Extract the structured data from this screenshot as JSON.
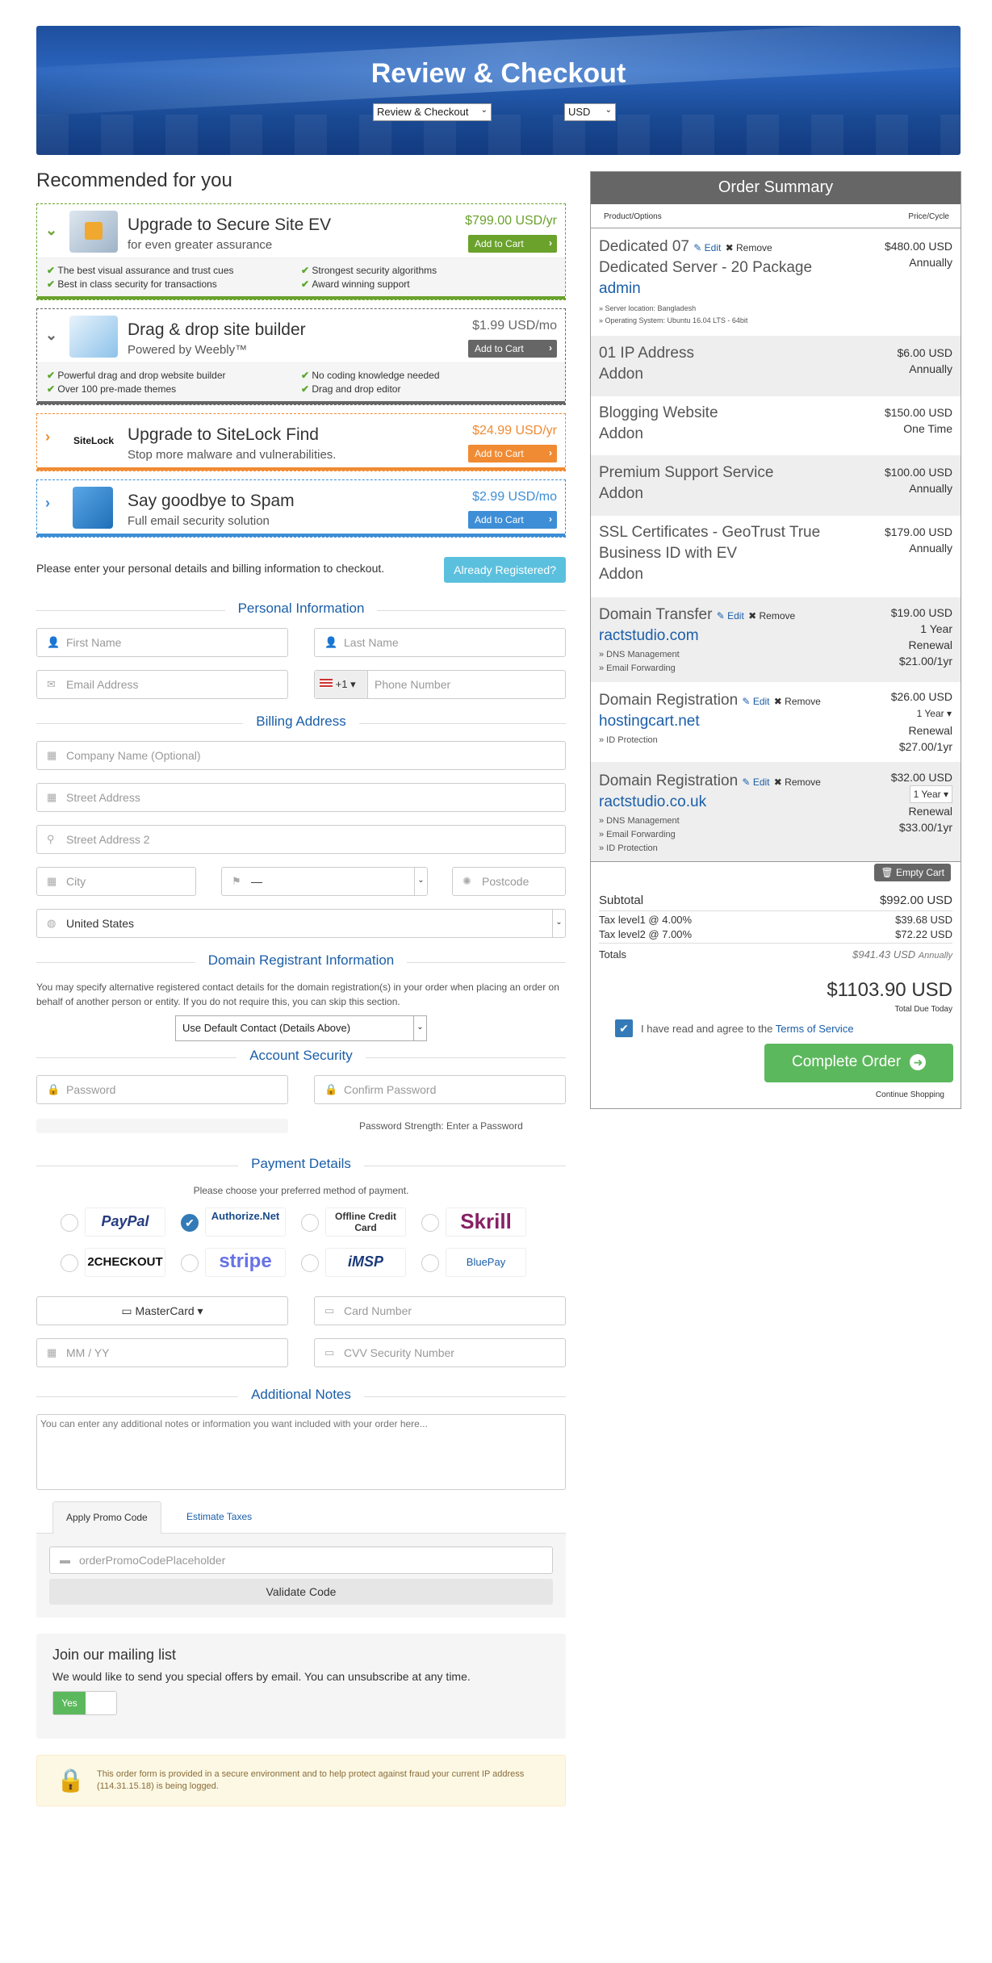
{
  "header": {
    "title": "Review & Checkout",
    "nav_select": "Review & Checkout",
    "currency": "USD"
  },
  "recommended": {
    "title": "Recommended for you",
    "items": [
      {
        "name": "Upgrade to Secure Site EV",
        "tagline": "for even greater assurance",
        "price": "$799.00 USD/yr",
        "button": "Add to Cart",
        "features": [
          "The best visual assurance and trust cues",
          "Strongest security algorithms",
          "Best in class security for transactions",
          "Award winning support"
        ],
        "accent": "#6aa22c"
      },
      {
        "name": "Drag & drop site builder",
        "tagline": "Powered by Weebly™",
        "price": "$1.99 USD/mo",
        "button": "Add to Cart",
        "features": [
          "Powerful drag and drop website builder",
          "No coding knowledge needed",
          "Over 100 pre-made themes",
          "Drag and drop editor"
        ],
        "accent": "#666666"
      },
      {
        "name": "Upgrade to SiteLock Find",
        "tagline": "Stop more malware and vulnerabilities.",
        "price": "$24.99 USD/yr",
        "button": "Add to Cart",
        "logo": "SiteLock",
        "accent": "#f08b33"
      },
      {
        "name": "Say goodbye to Spam",
        "tagline": "Full email security solution",
        "price": "$2.99 USD/mo",
        "button": "Add to Cart",
        "accent": "#3d8ed6"
      }
    ]
  },
  "form": {
    "intro": "Please enter your personal details and billing information to checkout.",
    "already_registered": "Already Registered?",
    "personal_title": "Personal Information",
    "first_name": "First Name",
    "last_name": "Last Name",
    "email": "Email Address",
    "phone_code": "+1",
    "phone": "Phone Number",
    "billing_title": "Billing Address",
    "company": "Company Name (Optional)",
    "street": "Street Address",
    "street2": "Street Address 2",
    "city": "City",
    "state": "—",
    "postcode": "Postcode",
    "country": "United States",
    "domain_title": "Domain Registrant Information",
    "domain_note": "You may specify alternative registered contact details for the domain registration(s) in your order when placing an order on behalf of another person or entity. If you do not require this, you can skip this section.",
    "domain_contact": "Use Default Contact (Details Above)",
    "security_title": "Account Security",
    "password": "Password",
    "confirm_password": "Confirm Password",
    "strength": "Password Strength: Enter a Password",
    "payment_title": "Payment Details",
    "payment_note": "Please choose your preferred method of payment.",
    "payment_methods": [
      {
        "label": "PayPal",
        "color": "#253b80"
      },
      {
        "label": "Authorize.Net",
        "color": "#1a4a8a",
        "selected": true
      },
      {
        "label": "Offline Credit Card",
        "color": "#333333"
      },
      {
        "label": "Skrill",
        "color": "#862165"
      },
      {
        "label": "2CHECKOUT",
        "color": "#111111"
      },
      {
        "label": "stripe",
        "color": "#6772e5"
      },
      {
        "label": "iMSP",
        "color": "#1a3a7a"
      },
      {
        "label": "BluePay",
        "color": "#1a5ea8"
      }
    ],
    "card_type": "MasterCard",
    "card_number": "Card Number",
    "expiry": "MM / YY",
    "cvv": "CVV Security Number",
    "notes_title": "Additional Notes",
    "notes_placeholder": "You can enter any additional notes or information you want included with your order here...",
    "promo_tab": "Apply Promo Code",
    "tax_tab": "Estimate Taxes",
    "promo_placeholder": "orderPromoCodePlaceholder",
    "validate": "Validate Code",
    "mailing_title": "Join our mailing list",
    "mailing_text": "We would like to send you special offers by email. You can unsubscribe at any time.",
    "mailing_yes": "Yes",
    "secure_text": "This order form is provided in a secure environment and to help protect against fraud your current IP address (114.31.15.18) is being logged."
  },
  "summary": {
    "title": "Order Summary",
    "col_product": "Product/Options",
    "col_price": "Price/Cycle",
    "edit": "Edit",
    "remove": "Remove",
    "items": [
      {
        "name": "Dedicated 07",
        "group": "Dedicated Server - 20 Package",
        "sub": "admin",
        "details": [
          "» Server location: Bangladesh",
          "» Operating System: Ubuntu 16.04 LTS - 64bit"
        ],
        "price": "$480.00 USD",
        "cycle": "Annually"
      },
      {
        "name": "01 IP Address",
        "sub": "Addon",
        "price": "$6.00 USD",
        "cycle": "Annually"
      },
      {
        "name": "Blogging Website",
        "sub": "Addon",
        "price": "$150.00 USD",
        "cycle": "One Time"
      },
      {
        "name": "Premium Support Service",
        "sub": "Addon",
        "price": "$100.00 USD",
        "cycle": "Annually"
      },
      {
        "name": "SSL Certificates - GeoTrust True",
        "name2": "Business ID with EV",
        "sub": "Addon",
        "price": "$179.00 USD",
        "cycle": "Annually"
      },
      {
        "name": "Domain Transfer",
        "domain": "ractstudio.com",
        "details": [
          "» DNS Management",
          "» Email Forwarding"
        ],
        "price": "$19.00 USD",
        "cycle": "1 Year",
        "renewal_label": "Renewal",
        "renewal": "$21.00/1yr"
      },
      {
        "name": "Domain Registration",
        "domain": "hostingcart.net",
        "details": [
          "» ID Protection"
        ],
        "price": "$26.00 USD",
        "cycle": "1 Year",
        "renewal_label": "Renewal",
        "renewal": "$27.00/1yr"
      },
      {
        "name": "Domain Registration",
        "domain": "ractstudio.co.uk",
        "details": [
          "» DNS Management",
          "» Email Forwarding",
          "» ID Protection"
        ],
        "price": "$32.00 USD",
        "cycle": "1 Year",
        "renewal_label": "Renewal",
        "renewal": "$33.00/1yr"
      }
    ],
    "empty_cart": "Empty Cart",
    "subtotal_label": "Subtotal",
    "subtotal": "$992.00 USD",
    "tax1_label": "Tax level1 @ 4.00%",
    "tax1": "$39.68 USD",
    "tax2_label": "Tax level2 @ 7.00%",
    "tax2": "$72.22 USD",
    "totals_label": "Totals",
    "totals": "$941.43 USD",
    "totals_cycle": "Annually",
    "grand_total": "$1103.90 USD",
    "due_label": "Total Due Today",
    "tos_text": "I have read and agree to the",
    "tos_link": "Terms of Service",
    "complete": "Complete Order",
    "continue": "Continue Shopping"
  }
}
